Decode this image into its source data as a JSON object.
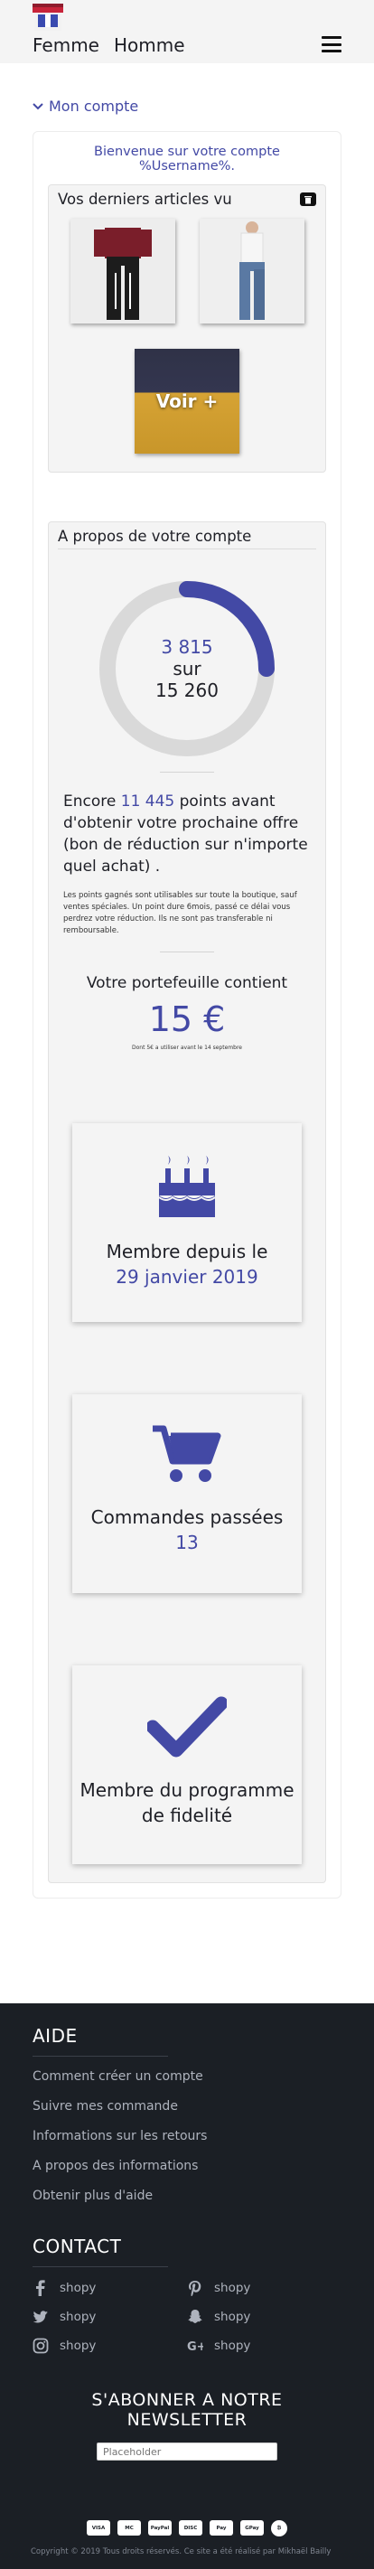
{
  "header": {
    "nav": [
      "Femme",
      "Homme"
    ]
  },
  "account": {
    "toggle_label": "Mon compte",
    "welcome": "Bienvenue sur votre compte %Username%."
  },
  "recent": {
    "title": "Vos derniers articles vu",
    "more_label": "Voir +"
  },
  "about": {
    "title": "A propos de votre compte",
    "ring": {
      "current": "3 815",
      "sep": "sur",
      "total": "15 260",
      "progress": 0.25,
      "color": "#4349a5",
      "track": "#d9d9d9"
    },
    "points_before": "Encore ",
    "points_value": "11 445",
    "points_after": " points avant d'obtenir votre prochaine offre (bon de réduction sur n'importe quel achat) .",
    "points_note": "Les points gagnés sont utilisables sur toute la boutique, sauf ventes spéciales. Un point dure 6mois, passé ce délai vous perdrez votre réduction. Ils ne sont pas transferable ni remboursable.",
    "wallet_title": "Votre portefeuille contient",
    "wallet_amount": "15 €",
    "wallet_note": "Dont 5€ a utiliser avant le 14 septembre"
  },
  "stats": [
    {
      "icon": "birthday-cake-icon",
      "title": "Membre depuis le",
      "value": "29 janvier 2019"
    },
    {
      "icon": "shopping-cart-icon",
      "title": "Commandes passées",
      "value": "13"
    },
    {
      "icon": "checkmark-icon",
      "title": "Membre du programme de fidelité",
      "value": ""
    }
  ],
  "footer": {
    "help_title": "AIDE",
    "help_links": [
      "Comment créer un compte",
      "Suivre mes commande",
      "Informations sur les retours",
      "A propos des informations",
      "Obtenir plus d'aide"
    ],
    "contact_title": "CONTACT",
    "contacts": [
      {
        "icon": "facebook-icon",
        "label": "shopy"
      },
      {
        "icon": "pinterest-icon",
        "label": "shopy"
      },
      {
        "icon": "twitter-icon",
        "label": "shopy"
      },
      {
        "icon": "snapchat-icon",
        "label": "shopy"
      },
      {
        "icon": "instagram-icon",
        "label": "shopy"
      },
      {
        "icon": "google-plus-icon",
        "label": "shopy"
      }
    ],
    "newsletter_title": "S'ABONNER A NOTRE NEWSLETTER",
    "newsletter_placeholder": "Placeholder",
    "payments": [
      "VISA",
      "MC",
      "PayPal",
      "DISC",
      "Pay",
      "GPay",
      "₿"
    ],
    "copyright": "Copyright © 2019 Tous droits réservés. Ce site a été réalisé par Mikhaël Bailly"
  },
  "colors": {
    "accent": "#4349a5",
    "footer_bg": "#1b1f25",
    "panel_bg": "#f4f4f4"
  }
}
